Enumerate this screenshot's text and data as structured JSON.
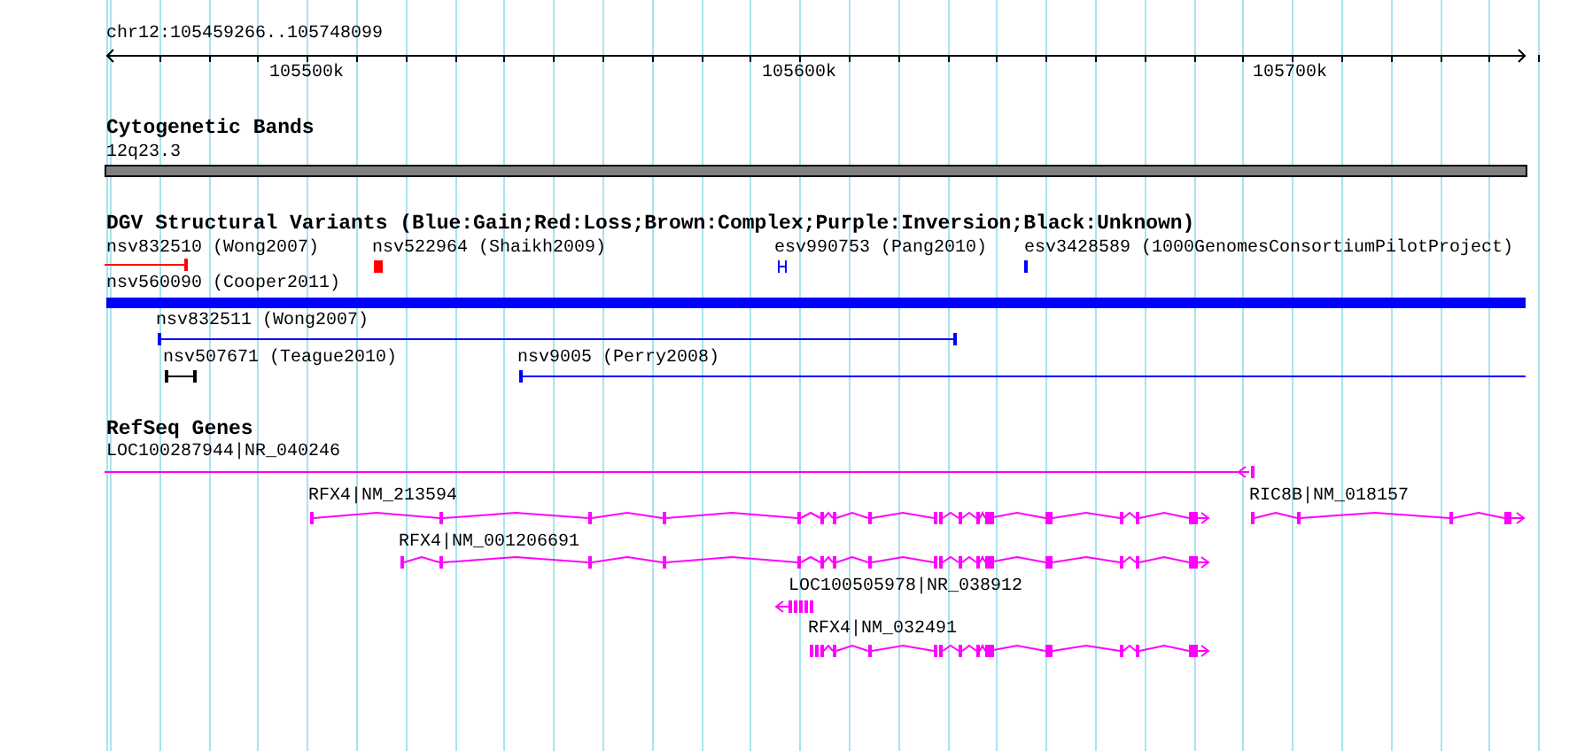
{
  "ruler": {
    "location": "chr12:105459266..105748099",
    "ticks": [
      "105500k",
      "105600k",
      "105700k"
    ]
  },
  "cytogenetic_bands": {
    "title": "Cytogenetic Bands",
    "band": "12q23.3"
  },
  "dgv_variants": {
    "title": "DGV Structural Variants (Blue:Gain;Red:Loss;Brown:Complex;Purple:Inversion;Black:Unknown)",
    "items": [
      {
        "label": "nsv832510 (Wong2007)",
        "color": "#ff0000"
      },
      {
        "label": "nsv522964 (Shaikh2009)",
        "color": "#ff0000"
      },
      {
        "label": "esv990753 (Pang2010)",
        "color": "#0000ff"
      },
      {
        "label": "esv3428589 (1000GenomesConsortiumPilotProject)",
        "color": "#0000ff"
      },
      {
        "label": "nsv560090 (Cooper2011)",
        "color": "#0000ff"
      },
      {
        "label": "nsv832511 (Wong2007)",
        "color": "#0000ff"
      },
      {
        "label": "nsv507671 (Teague2010)",
        "color": "#000000"
      },
      {
        "label": "nsv9005 (Perry2008)",
        "color": "#0000ff"
      }
    ]
  },
  "refseq_genes": {
    "title": "RefSeq Genes",
    "items": [
      {
        "label": "LOC100287944|NR_040246",
        "reverse": true
      },
      {
        "label": "RFX4|NM_213594",
        "reverse": false
      },
      {
        "label": "RFX4|NM_001206691",
        "reverse": false
      },
      {
        "label": "RIC8B|NM_018157",
        "reverse": false
      },
      {
        "label": "LOC100505978|NR_038912",
        "reverse": true
      },
      {
        "label": "RFX4|NM_032491",
        "reverse": false
      }
    ]
  }
}
